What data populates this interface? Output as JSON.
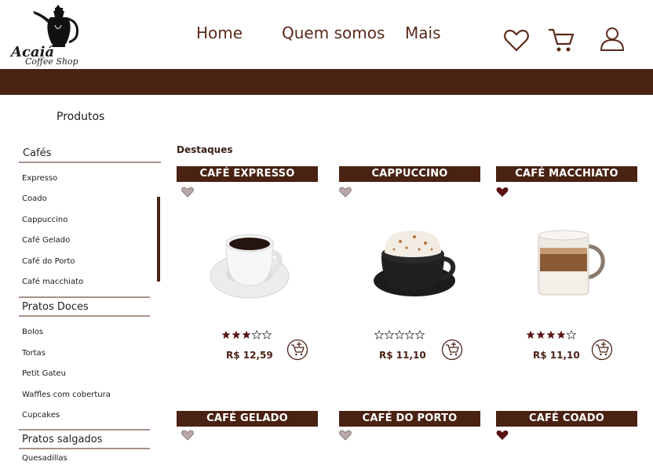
{
  "header": {
    "logo": {
      "name_line1": "Acaiá",
      "name_line2": "Coffee Shop"
    },
    "nav": {
      "home": "Home",
      "about": "Quem somos",
      "more": "Mais"
    }
  },
  "breadcrumb": "Produtos",
  "sidebar": {
    "categories": [
      {
        "title": "Cafés",
        "items": [
          "Expresso",
          "Coado",
          "Cappuccino",
          "Café Gelado",
          "Café do Porto",
          "Café macchiato"
        ]
      },
      {
        "title": "Pratos Doces",
        "items": [
          "Bolos",
          "Tortas",
          "Petit Gateu",
          "Waffles com cobertura",
          "Cupcakes"
        ]
      },
      {
        "title": "Pratos salgados",
        "items": [
          "Quesadillas"
        ]
      }
    ]
  },
  "main": {
    "section_title": "Destaques",
    "products": [
      {
        "name": "CAFÉ EXPRESSO",
        "price": "R$ 12,59",
        "rating": 3,
        "favorited": false
      },
      {
        "name": "CAPPUCCINO",
        "price": "R$ 11,10",
        "rating": 0,
        "favorited": false
      },
      {
        "name": "CAFÉ MACCHIATO",
        "price": "R$ 11,10",
        "rating": 4,
        "favorited": true
      },
      {
        "name": "CAFÉ GELADO",
        "favorited": false
      },
      {
        "name": "CAFÉ DO PORTO",
        "favorited": false
      },
      {
        "name": "CAFÉ COADO",
        "favorited": true
      }
    ]
  },
  "colors": {
    "brand_brown": "#4a2214",
    "heart_empty": "#b9a8a8",
    "heart_filled": "#5a1010",
    "star_filled": "#5a1515"
  },
  "icons": {
    "favorites": "heart-icon",
    "cart": "cart-icon",
    "account": "user-icon",
    "add_to_cart": "cart-plus-icon"
  }
}
